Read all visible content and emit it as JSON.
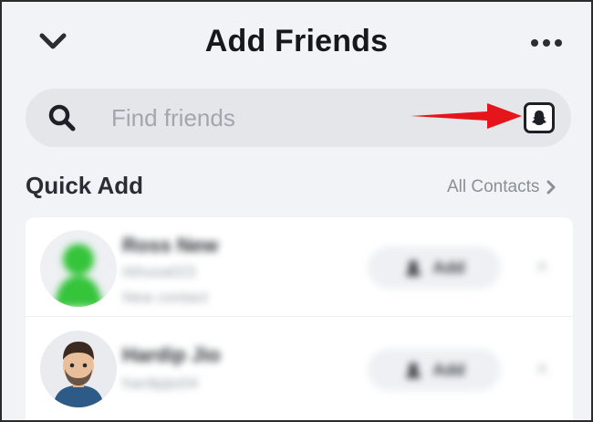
{
  "header": {
    "title": "Add Friends",
    "back_icon": "chevron-down-icon",
    "more_icon": "more-dots-icon"
  },
  "search": {
    "placeholder": "Find friends",
    "value": "",
    "icon": "search-icon",
    "snapcode_icon": "snapcode-ghost-icon",
    "arrow_color": "#e5161b"
  },
  "quick_add": {
    "title": "Quick Add",
    "all_contacts_label": "All Contacts",
    "rows": [
      {
        "name": "Ross New",
        "username": "rbhusa023",
        "subtitle": "New contact",
        "add_label": "Add",
        "avatar": "green-silhouette"
      },
      {
        "name": "Hardip Jio",
        "username": "hardipjio04",
        "subtitle": "",
        "add_label": "Add",
        "avatar": "bitmoji-man"
      }
    ]
  },
  "colors": {
    "background": "#f2f3f6",
    "search_bg": "#e4e6ea",
    "title_text": "#16191c",
    "muted_text": "#8a8f97"
  }
}
